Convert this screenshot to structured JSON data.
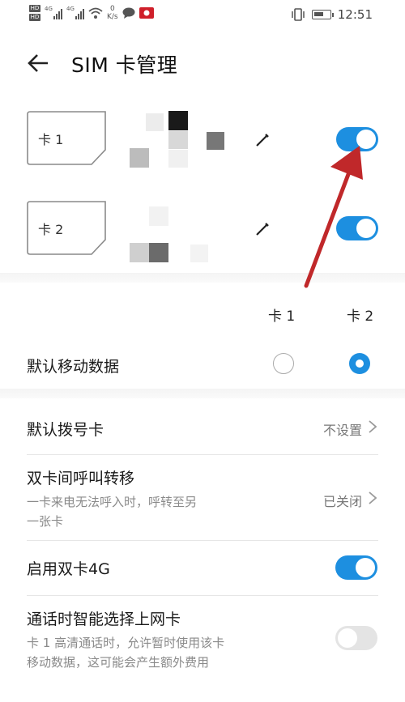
{
  "status_bar": {
    "hd_1": "HD",
    "hd_2": "HD",
    "sim1_network": "4G",
    "sim2_network": "4G",
    "speed_value": "0",
    "speed_unit": "K/s",
    "time": "12:51"
  },
  "header": {
    "title": "SIM 卡管理"
  },
  "sims": [
    {
      "label": "卡 1",
      "enabled": true
    },
    {
      "label": "卡 2",
      "enabled": true
    }
  ],
  "columns": {
    "card1": "卡 1",
    "card2": "卡 2"
  },
  "default_data": {
    "label": "默认移动数据",
    "selected": "card2"
  },
  "settings": {
    "default_dial": {
      "label": "默认拨号卡",
      "value": "不设置"
    },
    "call_forward": {
      "label": "双卡间呼叫转移",
      "desc_line1": "一卡来电无法呼入时，呼转至另",
      "desc_line2": "一张卡",
      "value": "已关闭"
    },
    "dual_4g": {
      "label": "启用双卡4G",
      "enabled": true
    },
    "smart_data": {
      "label": "通话时智能选择上网卡",
      "desc_line1": "卡 1 高清通话时，允许暂时使用该卡",
      "desc_line2": "移动数据，这可能会产生额外费用",
      "enabled": false
    }
  },
  "colors": {
    "accent": "#1d8fe0",
    "annotation_arrow": "#c0282a"
  }
}
